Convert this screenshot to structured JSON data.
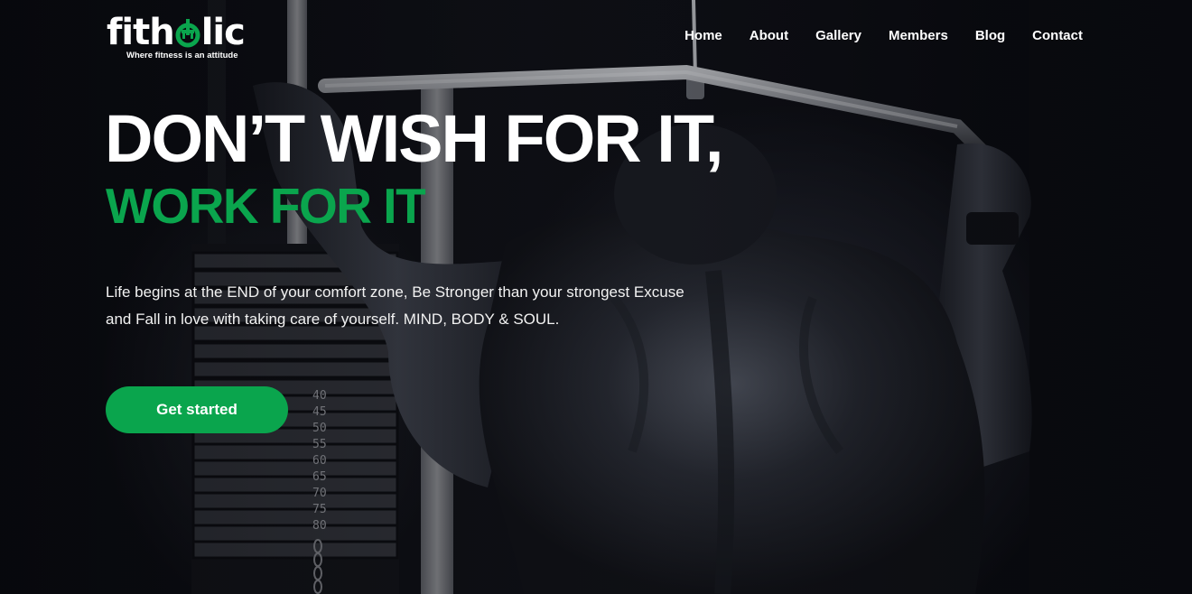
{
  "brand": {
    "logo_prefix": "fith",
    "logo_suffix": "lic",
    "tagline": "Where fitness is an attitude",
    "accent_color": "#0aa54d",
    "logo_icon": "dumbbell-icon"
  },
  "nav": {
    "items": [
      {
        "label": "Home"
      },
      {
        "label": "About"
      },
      {
        "label": "Gallery"
      },
      {
        "label": "Members"
      },
      {
        "label": "Blog"
      },
      {
        "label": "Contact"
      }
    ]
  },
  "hero": {
    "headline": "DON’T WISH FOR IT,",
    "subheadline": "WORK FOR IT",
    "description": "Life begins at the END of your comfort zone, Be Stronger than your strongest Excuse and Fall in love with taking care of yourself. MIND, BODY & SOUL.",
    "cta_label": "Get started",
    "weight_labels": [
      "40",
      "45",
      "50",
      "55",
      "60",
      "65",
      "70",
      "75",
      "80"
    ]
  }
}
